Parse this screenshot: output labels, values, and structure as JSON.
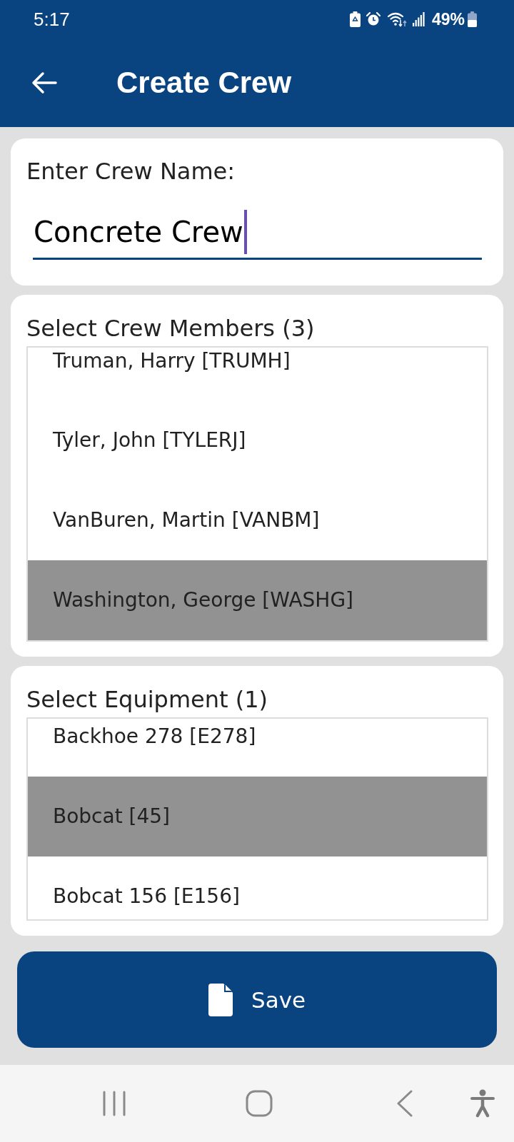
{
  "status_bar": {
    "time": "5:17",
    "battery": "49%"
  },
  "header": {
    "title": "Create Crew"
  },
  "name_card": {
    "label": "Enter Crew Name:",
    "value": "Concrete Crew",
    "focused": true
  },
  "crew_members": {
    "label": "Select Crew Members (3)",
    "items": [
      {
        "label": "Truman, Harry [TRUMH]",
        "selected": false
      },
      {
        "label": "Tyler, John [TYLERJ]",
        "selected": false
      },
      {
        "label": "VanBuren, Martin [VANBM]",
        "selected": false
      },
      {
        "label": "Washington, George [WASHG]",
        "selected": true
      }
    ]
  },
  "equipment": {
    "label": "Select Equipment (1)",
    "items": [
      {
        "label": "Backhoe 278 [E278]",
        "selected": false
      },
      {
        "label": "Bobcat [45]",
        "selected": true
      },
      {
        "label": "Bobcat 156 [E156]",
        "selected": false
      }
    ]
  },
  "save_button": {
    "label": "Save"
  }
}
